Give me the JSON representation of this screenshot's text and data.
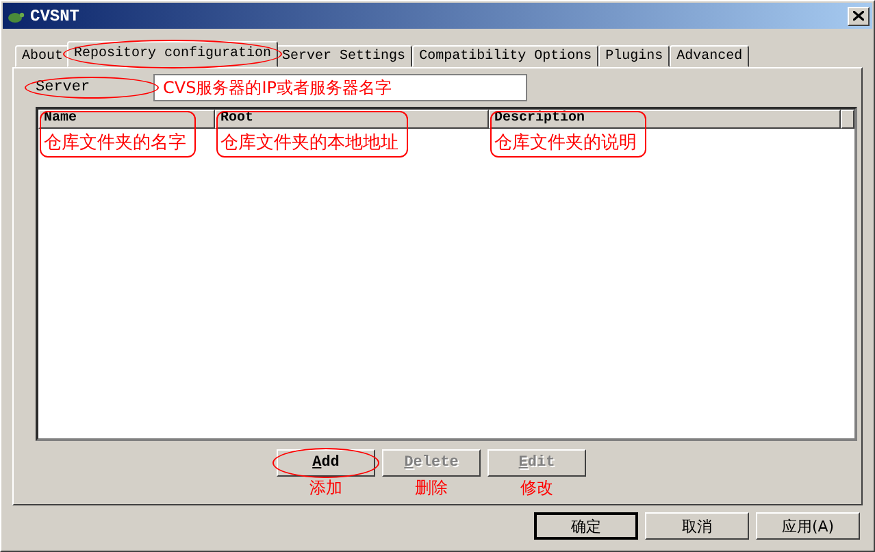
{
  "window": {
    "title": "CVSNT"
  },
  "tabs": [
    {
      "label": "About",
      "selected": false,
      "circled": false
    },
    {
      "label": "Repository configuration",
      "selected": true,
      "circled": true
    },
    {
      "label": "Server Settings",
      "selected": false,
      "circled": false
    },
    {
      "label": "Compatibility Options",
      "selected": false,
      "circled": false
    },
    {
      "label": "Plugins",
      "selected": false,
      "circled": false
    },
    {
      "label": "Advanced",
      "selected": false,
      "circled": false
    }
  ],
  "server": {
    "label": "Server",
    "circled": true,
    "value": "CVS服务器的IP或者服务器名字"
  },
  "table": {
    "columns": [
      {
        "label": "Name",
        "circled": true
      },
      {
        "label": "Root",
        "circled": true
      },
      {
        "label": "Description",
        "circled": true
      }
    ],
    "rows": [
      {
        "cells": [
          "仓库文件夹的名字",
          "仓库文件夹的本地地址",
          "仓库文件夹的说明"
        ]
      }
    ]
  },
  "actions": [
    {
      "label": "Add",
      "disabled": false,
      "circled": true,
      "note": "添加"
    },
    {
      "label": "Delete",
      "disabled": true,
      "circled": false,
      "note": "删除"
    },
    {
      "label": "Edit",
      "disabled": true,
      "circled": false,
      "note": "修改"
    }
  ],
  "footer": [
    {
      "label": "确定",
      "default": true
    },
    {
      "label": "取消",
      "default": false
    },
    {
      "label": "应用(A)",
      "default": false
    }
  ]
}
